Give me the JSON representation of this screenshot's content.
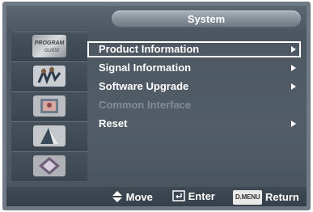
{
  "header": {
    "title": "System"
  },
  "sidebar": {
    "items": [
      {
        "icon": "program-guide-icon",
        "label": "PROGRAM GUIDE"
      },
      {
        "icon": "channel-icon"
      },
      {
        "icon": "picture-icon"
      },
      {
        "icon": "sound-icon"
      },
      {
        "icon": "setup-icon"
      }
    ]
  },
  "menu": {
    "items": [
      {
        "label": "Product Information",
        "selected": true,
        "enabled": true,
        "has_submenu": true
      },
      {
        "label": "Signal Information",
        "selected": false,
        "enabled": true,
        "has_submenu": true
      },
      {
        "label": "Software Upgrade",
        "selected": false,
        "enabled": true,
        "has_submenu": true
      },
      {
        "label": "Common Interface",
        "selected": false,
        "enabled": false,
        "has_submenu": false
      },
      {
        "label": "Reset",
        "selected": false,
        "enabled": true,
        "has_submenu": true
      }
    ]
  },
  "footer": {
    "move_label": "Move",
    "enter_label": "Enter",
    "menu_badge": "D.MENU",
    "return_label": "Return"
  },
  "colors": {
    "highlight_border": "#ffffff",
    "disabled_text": "#838c94",
    "screen_bg": "#4a5560"
  }
}
